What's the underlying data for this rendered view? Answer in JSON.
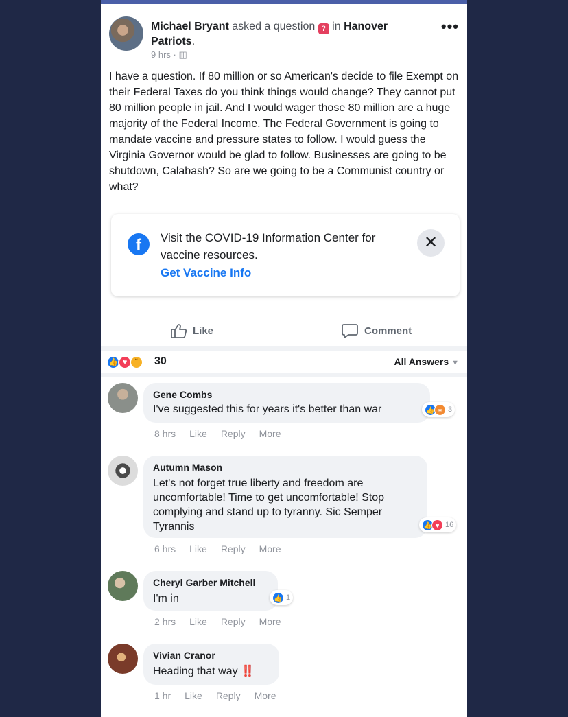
{
  "post": {
    "author": "Michael Bryant",
    "action": "asked a question",
    "in_word": "in",
    "group": "Hanover Patriots",
    "period": ".",
    "time": "9 hrs",
    "meta_sep": "·",
    "more_glyph": "•••",
    "body": "I have a question. If 80 million or so American's decide to file Exempt on their Federal Taxes do you think things would change? They cannot put 80 million people in jail. And I would wager those 80 million are a huge majority of the Federal Income. The Federal Government is going to mandate vaccine and pressure states to follow. I would guess the Virginia Governor would be glad to follow. Businesses are going to be shutdown, Calabash? So are we going to be a Communist country or what?"
  },
  "covid_card": {
    "text": "Visit the COVID-19 Information Center for vaccine resources.",
    "link": "Get Vaccine Info",
    "logo_letter": "f",
    "close_glyph": "✕"
  },
  "actions": {
    "like": "Like",
    "comment": "Comment"
  },
  "reactions": {
    "count": "30",
    "sort_label": "All Answers",
    "icons": [
      "like-icon",
      "love-icon",
      "sad-icon"
    ]
  },
  "comments": [
    {
      "name": "Gene Combs",
      "text": "I've suggested this for years it's better than war",
      "react_count": "3",
      "time": "8 hrs",
      "like": "Like",
      "reply": "Reply",
      "more": "More"
    },
    {
      "name": "Autumn Mason",
      "text": "Let's not forget true liberty and freedom are uncomfortable! Time to get uncomfortable! Stop complying and stand up to tyranny. Sic Semper Tyrannis",
      "react_count": "16",
      "time": "6 hrs",
      "like": "Like",
      "reply": "Reply",
      "more": "More"
    },
    {
      "name": "Cheryl Garber Mitchell",
      "text": "I'm in",
      "react_count": "1",
      "time": "2 hrs",
      "like": "Like",
      "reply": "Reply",
      "more": "More"
    },
    {
      "name": "Vivian Cranor",
      "text": "Heading that way",
      "emoji": "‼️",
      "time": "1 hr",
      "like": "Like",
      "reply": "Reply",
      "more": "More"
    }
  ],
  "colors": {
    "background": "#1f2846",
    "facebook_blue": "#1877f2",
    "bubble": "#f0f2f5"
  }
}
